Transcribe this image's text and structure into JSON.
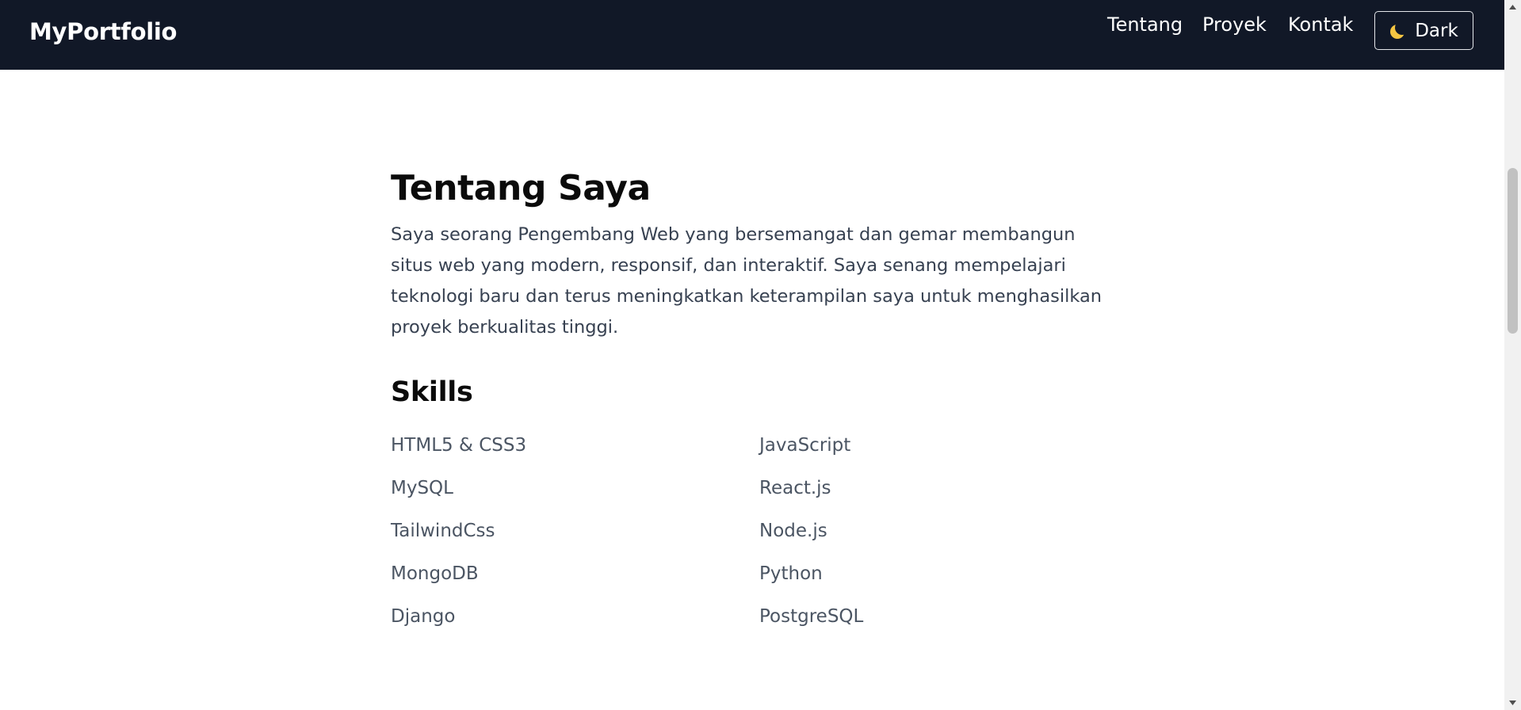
{
  "navbar": {
    "brand": "MyPortfolio",
    "links": [
      "Tentang",
      "Proyek",
      "Kontak"
    ],
    "theme_toggle_label": "Dark",
    "theme_toggle_icon": "moon-icon",
    "background_color": "#111827"
  },
  "about": {
    "title": "Tentang Saya",
    "text": "Saya seorang Pengembang Web yang bersemangat dan gemar membangun situs web yang modern, responsif, dan interaktif. Saya senang mempelajari teknologi baru dan terus meningkatkan keterampilan saya untuk menghasilkan proyek berkualitas tinggi."
  },
  "skills": {
    "title": "Skills",
    "items": [
      "HTML5 & CSS3",
      "JavaScript",
      "MySQL",
      "React.js",
      "TailwindCss",
      "Node.js",
      "MongoDB",
      "Python",
      "Django",
      "PostgreSQL"
    ]
  }
}
